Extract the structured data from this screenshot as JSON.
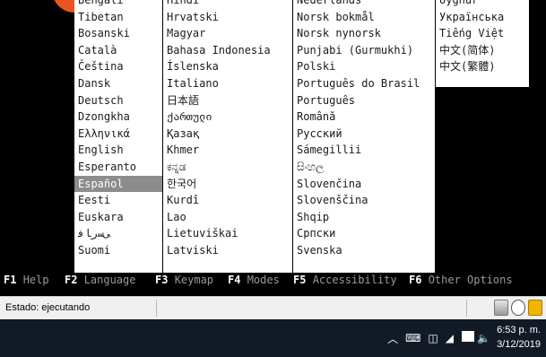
{
  "language_menu": {
    "columns": [
      [
        "Bengali",
        "Tibetan",
        "Bosanski",
        "Català",
        "Čeština",
        "Dansk",
        "Deutsch",
        "Dzongkha",
        "Ελληνικά",
        "English",
        "Esperanto",
        "Español",
        "Eesti",
        "Euskara",
        "ﻰﺳﺭﺎﻓ",
        "Suomi"
      ],
      [
        "Hindi",
        "Hrvatski",
        "Magyar",
        "Bahasa Indonesia",
        "Íslenska",
        "Italiano",
        "日本語",
        "ქართული",
        "Қазақ",
        "Khmer",
        "ಕನ್ನಡ",
        "한국어",
        "Kurdî",
        "Lao",
        "Lietuviškai",
        "Latviski"
      ],
      [
        "Nederlands",
        "Norsk bokmål",
        "Norsk nynorsk",
        "Punjabi (Gurmukhi)",
        "Polski",
        "Português do Brasil",
        "Português",
        "Română",
        "Русский",
        "Sámegillii",
        "සිංහල",
        "Slovenčina",
        "Slovenščina",
        "Shqip",
        "Српски",
        "Svenska"
      ],
      [
        "Uyghur",
        "Українська",
        "Tiếng Việt",
        "中文(简体)",
        "中文(繁體)"
      ]
    ],
    "selected": "Español"
  },
  "function_bar": [
    {
      "key": "F1",
      "label": "Help"
    },
    {
      "key": "F2",
      "label": "Language"
    },
    {
      "key": "F3",
      "label": "Keymap"
    },
    {
      "key": "F4",
      "label": "Modes"
    },
    {
      "key": "F5",
      "label": "Accessibility"
    },
    {
      "key": "F6",
      "label": "Other Options"
    }
  ],
  "vm_statusbar": {
    "status": "Estado: ejecutando",
    "icons": [
      "hard-disk-icon",
      "cd-rom-icon",
      "lock-icon"
    ],
    "icon_colors": {
      "lock": "#f1b400"
    }
  },
  "taskbar": {
    "tray_icons": [
      "chevron-up-icon",
      "keyboard-icon",
      "network-icon",
      "wifi-icon",
      "bluetooth-icon",
      "volume-icon",
      "notification-icon"
    ],
    "time": "6:53 p. m.",
    "date": "3/12/2019"
  },
  "colors": {
    "brand_orange": "#e95420",
    "selection": "#8c8c8c",
    "taskbar": "#121a26"
  }
}
